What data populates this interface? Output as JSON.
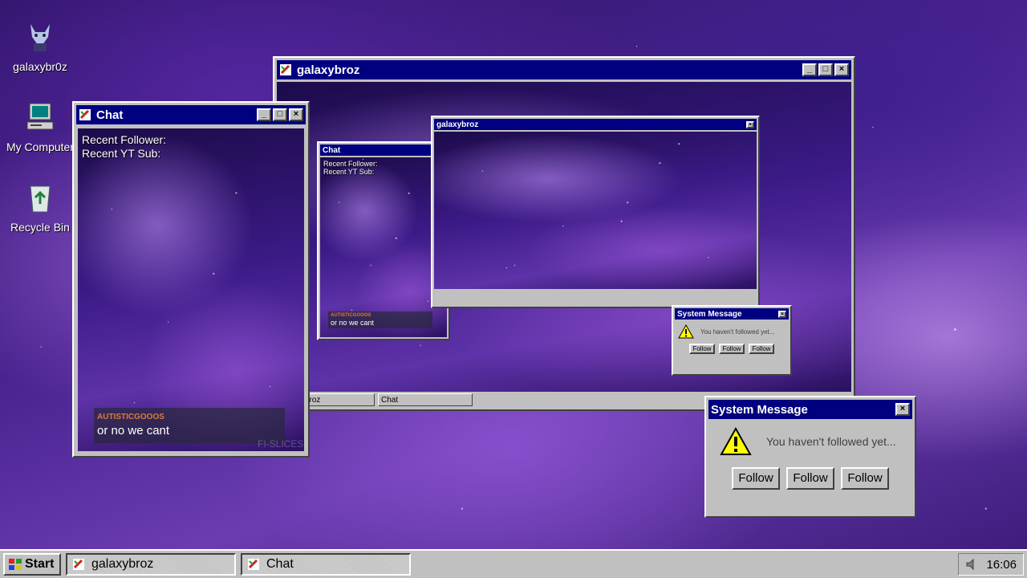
{
  "desktop_icons": [
    {
      "label": "galaxybr0z",
      "icon": "wolf-avatar-icon"
    },
    {
      "label": "My Computer",
      "icon": "computer-icon"
    },
    {
      "label": "Recycle Bin",
      "icon": "recycle-bin-icon"
    }
  ],
  "main_window": {
    "title": "galaxybroz",
    "mini_taskbar": {
      "item1": "galaxybroz",
      "item2": "Chat"
    },
    "nested_chat": {
      "title": "Chat",
      "recent_follower": "Recent Follower:",
      "recent_sub": "Recent YT Sub:",
      "username": "AUTISTICGOOOS",
      "message": "or no we cant"
    },
    "nested_window_title": "galaxybroz",
    "nested_system_message": {
      "title": "System Message",
      "text": "You haven't followed yet...",
      "buttons": [
        "Follow",
        "Follow",
        "Follow"
      ]
    }
  },
  "chat_window": {
    "title": "Chat",
    "recent_follower": "Recent Follower:",
    "recent_sub": "Recent YT Sub:",
    "username": "AUTISTICGOOOS",
    "message": "or no we cant",
    "watermark": "FI-SLICES"
  },
  "system_message": {
    "title": "System Message",
    "text": "You haven't followed yet...",
    "buttons": [
      "Follow",
      "Follow",
      "Follow"
    ]
  },
  "taskbar": {
    "start_label": "Start",
    "tasks": [
      "galaxybroz",
      "Chat"
    ],
    "clock": "16:06"
  },
  "colors": {
    "title_bar": "#000080",
    "chrome": "#c0c0c0",
    "username": "#e07840"
  }
}
